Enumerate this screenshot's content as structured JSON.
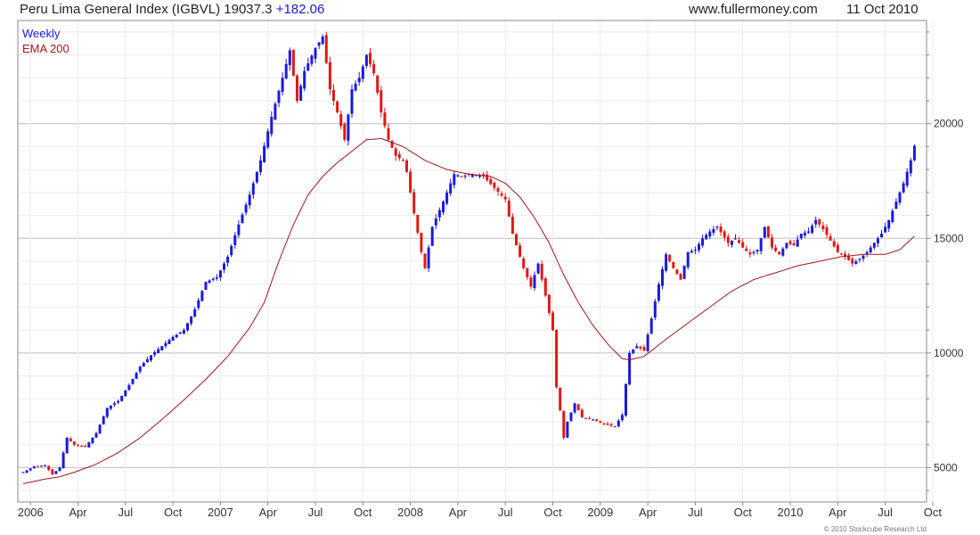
{
  "header": {
    "title": "Peru Lima General Index (IGBVL)",
    "last_value": "19037.3",
    "change": "+182.06",
    "website": "www.fullermoney.com",
    "date": "11 Oct 2010"
  },
  "copyright": "© 2010 Stockcube Research Ltd",
  "colors": {
    "up": "#1a1adc",
    "down": "#e01818",
    "ema": "#a01818",
    "grid": "#d8d8d8",
    "frame": "#888888"
  },
  "chart_data": {
    "type": "candlestick",
    "title": "Peru Lima General Index (IGBVL)",
    "legend": [
      "Weekly",
      "EMA 200"
    ],
    "legend_placement": "top-left",
    "ylim": [
      3500,
      24500
    ],
    "y_ticks": [
      5000,
      10000,
      15000,
      20000
    ],
    "y_axis_side": "right",
    "grid": true,
    "x_ticks": [
      {
        "label": "2006",
        "week": 2
      },
      {
        "label": "Apr",
        "week": 15
      },
      {
        "label": "Jul",
        "week": 28
      },
      {
        "label": "Oct",
        "week": 41
      },
      {
        "label": "2007",
        "week": 54
      },
      {
        "label": "Apr",
        "week": 67
      },
      {
        "label": "Jul",
        "week": 80
      },
      {
        "label": "Oct",
        "week": 93
      },
      {
        "label": "2008",
        "week": 106
      },
      {
        "label": "Apr",
        "week": 119
      },
      {
        "label": "Jul",
        "week": 132
      },
      {
        "label": "Oct",
        "week": 145
      },
      {
        "label": "2009",
        "week": 158
      },
      {
        "label": "Apr",
        "week": 171
      },
      {
        "label": "Jul",
        "week": 184
      },
      {
        "label": "Oct",
        "week": 197
      },
      {
        "label": "2010",
        "week": 210
      },
      {
        "label": "Apr",
        "week": 223
      },
      {
        "label": "Jul",
        "week": 236
      },
      {
        "label": "Oct",
        "week": 249
      }
    ],
    "weekly_close_anchors": [
      [
        0,
        4800
      ],
      [
        3,
        5050
      ],
      [
        6,
        5100
      ],
      [
        8,
        4700
      ],
      [
        10,
        5000
      ],
      [
        12,
        6300
      ],
      [
        14,
        6000
      ],
      [
        17,
        5900
      ],
      [
        20,
        6500
      ],
      [
        23,
        7600
      ],
      [
        26,
        7900
      ],
      [
        29,
        8600
      ],
      [
        32,
        9400
      ],
      [
        35,
        9900
      ],
      [
        38,
        10300
      ],
      [
        41,
        10700
      ],
      [
        44,
        11000
      ],
      [
        47,
        11900
      ],
      [
        50,
        13100
      ],
      [
        53,
        13300
      ],
      [
        56,
        14200
      ],
      [
        59,
        15600
      ],
      [
        62,
        16900
      ],
      [
        65,
        18400
      ],
      [
        68,
        20300
      ],
      [
        71,
        22000
      ],
      [
        73,
        23200
      ],
      [
        75,
        21000
      ],
      [
        77,
        22300
      ],
      [
        80,
        23300
      ],
      [
        82,
        23800
      ],
      [
        84,
        21500
      ],
      [
        86,
        20500
      ],
      [
        88,
        19300
      ],
      [
        90,
        21500
      ],
      [
        92,
        22000
      ],
      [
        94,
        23000
      ],
      [
        96,
        22200
      ],
      [
        98,
        20500
      ],
      [
        100,
        19300
      ],
      [
        102,
        18600
      ],
      [
        104,
        18400
      ],
      [
        105,
        17900
      ],
      [
        107,
        16100
      ],
      [
        109,
        14400
      ],
      [
        110,
        13700
      ],
      [
        112,
        15500
      ],
      [
        115,
        16600
      ],
      [
        118,
        17800
      ],
      [
        120,
        17700
      ],
      [
        123,
        17800
      ],
      [
        126,
        17700
      ],
      [
        129,
        17200
      ],
      [
        132,
        16700
      ],
      [
        134,
        15200
      ],
      [
        137,
        13700
      ],
      [
        139,
        12900
      ],
      [
        141,
        13900
      ],
      [
        143,
        12500
      ],
      [
        145,
        11000
      ],
      [
        146,
        8500
      ],
      [
        147,
        7500
      ],
      [
        148,
        6300
      ],
      [
        149,
        7000
      ],
      [
        151,
        7800
      ],
      [
        153,
        7200
      ],
      [
        156,
        7100
      ],
      [
        159,
        6900
      ],
      [
        162,
        6800
      ],
      [
        164,
        7300
      ],
      [
        166,
        10000
      ],
      [
        168,
        10300
      ],
      [
        170,
        10100
      ],
      [
        172,
        11500
      ],
      [
        174,
        13000
      ],
      [
        176,
        14300
      ],
      [
        178,
        13700
      ],
      [
        180,
        13200
      ],
      [
        182,
        14400
      ],
      [
        184,
        14500
      ],
      [
        186,
        15000
      ],
      [
        188,
        15300
      ],
      [
        190,
        15500
      ],
      [
        193,
        14800
      ],
      [
        195,
        15000
      ],
      [
        197,
        14600
      ],
      [
        199,
        14300
      ],
      [
        201,
        14500
      ],
      [
        203,
        15500
      ],
      [
        205,
        14600
      ],
      [
        207,
        14300
      ],
      [
        209,
        14800
      ],
      [
        211,
        14700
      ],
      [
        213,
        15200
      ],
      [
        215,
        15300
      ],
      [
        217,
        15800
      ],
      [
        219,
        15400
      ],
      [
        221,
        14900
      ],
      [
        223,
        14400
      ],
      [
        225,
        14200
      ],
      [
        227,
        13900
      ],
      [
        229,
        14100
      ],
      [
        231,
        14400
      ],
      [
        233,
        14800
      ],
      [
        235,
        15200
      ],
      [
        237,
        15800
      ],
      [
        239,
        16600
      ],
      [
        241,
        17400
      ],
      [
        243,
        18400
      ],
      [
        244,
        19037
      ]
    ],
    "ema_200_anchors": [
      [
        0,
        4300
      ],
      [
        6,
        4500
      ],
      [
        10,
        4600
      ],
      [
        14,
        4800
      ],
      [
        20,
        5150
      ],
      [
        26,
        5650
      ],
      [
        32,
        6300
      ],
      [
        38,
        7100
      ],
      [
        44,
        7950
      ],
      [
        50,
        8850
      ],
      [
        56,
        9850
      ],
      [
        62,
        11100
      ],
      [
        66,
        12200
      ],
      [
        70,
        14000
      ],
      [
        74,
        15600
      ],
      [
        78,
        16900
      ],
      [
        82,
        17700
      ],
      [
        86,
        18300
      ],
      [
        90,
        18800
      ],
      [
        94,
        19300
      ],
      [
        98,
        19350
      ],
      [
        104,
        19000
      ],
      [
        110,
        18400
      ],
      [
        116,
        18000
      ],
      [
        122,
        17800
      ],
      [
        128,
        17700
      ],
      [
        132,
        17400
      ],
      [
        136,
        16800
      ],
      [
        140,
        15900
      ],
      [
        144,
        14800
      ],
      [
        148,
        13400
      ],
      [
        152,
        12200
      ],
      [
        156,
        11200
      ],
      [
        160,
        10400
      ],
      [
        164,
        9750
      ],
      [
        166,
        9700
      ],
      [
        170,
        9850
      ],
      [
        176,
        10600
      ],
      [
        182,
        11300
      ],
      [
        188,
        12000
      ],
      [
        194,
        12700
      ],
      [
        200,
        13200
      ],
      [
        206,
        13500
      ],
      [
        212,
        13800
      ],
      [
        218,
        14000
      ],
      [
        224,
        14200
      ],
      [
        230,
        14300
      ],
      [
        236,
        14300
      ],
      [
        240,
        14500
      ],
      [
        244,
        15100
      ]
    ]
  }
}
